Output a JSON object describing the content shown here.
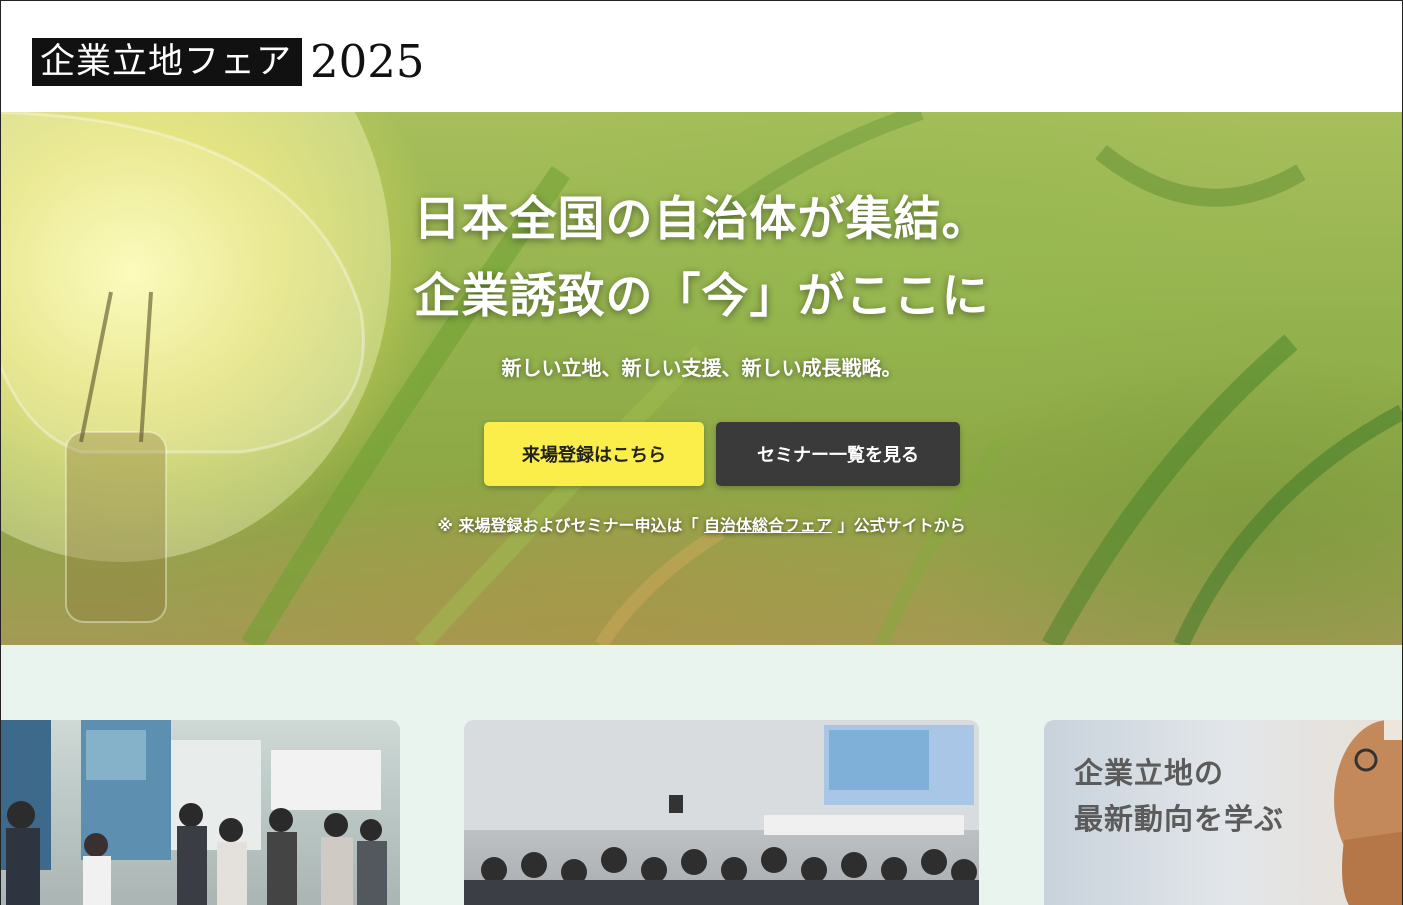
{
  "header": {
    "logo_text": "企業立地フェア",
    "logo_year": "2025"
  },
  "hero": {
    "title_line1": "日本全国の自治体が集結。",
    "title_line2": "企業誘致の「今」がここに",
    "subtitle": "新しい立地、新しい支援、新しい成長戦略。",
    "register_button": "来場登録はこちら",
    "seminar_button": "セミナー一覧を見る",
    "note_prefix": "※ 来場登録およびセミナー申込は「 ",
    "note_link": "自治体総合フェア",
    "note_suffix": " 」公式サイトから",
    "colors": {
      "register_bg": "#fbee4a",
      "seminar_bg": "#3a3a3a"
    }
  },
  "cards": {
    "card3_title_line1": "企業立地の",
    "card3_title_line2": "最新動向を学ぶ"
  }
}
